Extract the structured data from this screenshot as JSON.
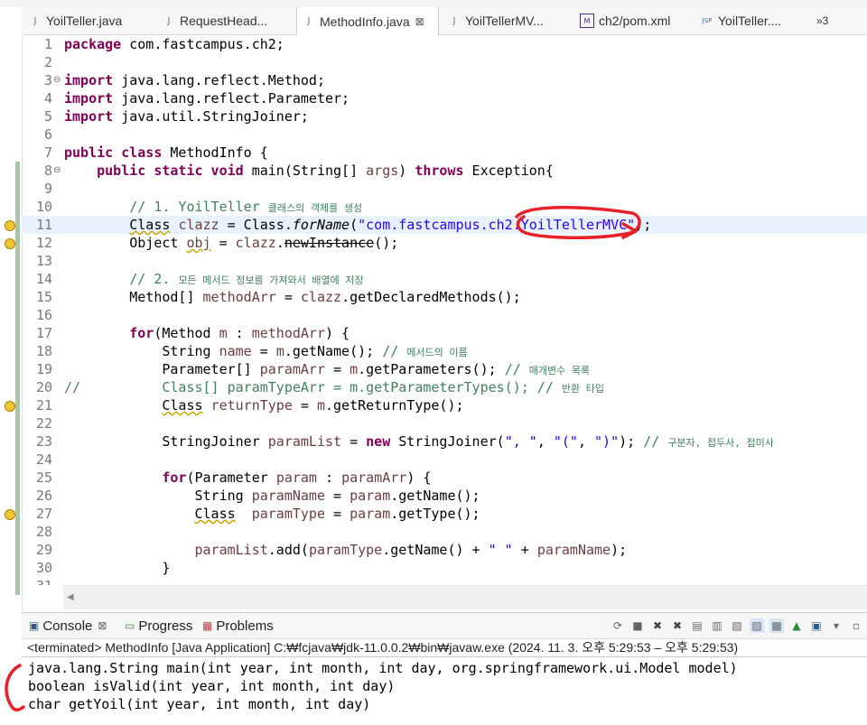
{
  "tabs": [
    {
      "label": "YoilTeller.java",
      "icon": "java-file-icon"
    },
    {
      "label": "RequestHead...",
      "icon": "java-file-icon"
    },
    {
      "label": "MethodInfo.java",
      "icon": "java-file-icon",
      "active": true,
      "close": "⊠"
    },
    {
      "label": "YoilTellerMV...",
      "icon": "java-file-icon"
    },
    {
      "label": "ch2/pom.xml",
      "icon": "maven-file-icon"
    },
    {
      "label": "YoilTeller....",
      "icon": "jsp-file-icon"
    }
  ],
  "overflow_label": "»3",
  "editor": {
    "lines": [
      {
        "n": "1",
        "h": "<span class='kw'>package</span> com.fastcampus.ch2;"
      },
      {
        "n": "2",
        "h": ""
      },
      {
        "n": "3",
        "h": "<span class='kw'>import</span> java.lang.reflect.Method;",
        "fold": true
      },
      {
        "n": "4",
        "h": "<span class='kw'>import</span> java.lang.reflect.Parameter;"
      },
      {
        "n": "5",
        "h": "<span class='kw'>import</span> java.util.StringJoiner;"
      },
      {
        "n": "6",
        "h": ""
      },
      {
        "n": "7",
        "h": "<span class='kw'>public class</span> MethodInfo {"
      },
      {
        "n": "8",
        "h": "    <span class='kw'>public static void</span> main(String[] <span class='var'>args</span>) <span class='kw'>throws</span> Exception{",
        "fold": true
      },
      {
        "n": "9",
        "h": ""
      },
      {
        "n": "10",
        "h": "        <span class='cm'>// 1. YoilTeller <span class='ko'>클래스의 객체를 생성</span></span>"
      },
      {
        "n": "11",
        "h": "        <span class='warn'>Class</span> <span class='var'>clazz</span> = Class.<span class='it'>forName</span>(<span class='str'>\"com.fastcampus.ch2.YoilTellerMVC\"</span>);",
        "cur": true,
        "warn": true
      },
      {
        "n": "12",
        "h": "        Object <span class='var warn'>obj</span> = <span class='var'>clazz</span>.<span class='strike'>newInstance</span>();",
        "warn": true
      },
      {
        "n": "13",
        "h": ""
      },
      {
        "n": "14",
        "h": "        <span class='cm'>// 2. <span class='ko'>모든 메서드 정보를 가져와서 배열에 저장</span></span>"
      },
      {
        "n": "15",
        "h": "        Method[] <span class='var'>methodArr</span> = <span class='var'>clazz</span>.getDeclaredMethods();"
      },
      {
        "n": "16",
        "h": ""
      },
      {
        "n": "17",
        "h": "        <span class='kw'>for</span>(Method <span class='var'>m</span> : <span class='var'>methodArr</span>) {"
      },
      {
        "n": "18",
        "h": "            String <span class='var'>name</span> = <span class='var'>m</span>.getName(); <span class='cm'>// <span class='ko'>메서드의 이름</span></span>"
      },
      {
        "n": "19",
        "h": "            Parameter[] <span class='var'>paramArr</span> = <span class='var'>m</span>.getParameters(); <span class='cm'>// <span class='ko'>매개변수 목록</span></span>"
      },
      {
        "n": "20",
        "h": "<span class='cm'>//          Class[] paramTypeArr = m.getParameterTypes(); // <span class='ko'>반환 타입</span></span>"
      },
      {
        "n": "21",
        "h": "            <span class='warn'>Class</span> <span class='var'>returnType</span> = <span class='var'>m</span>.getReturnType();",
        "warn": true
      },
      {
        "n": "22",
        "h": ""
      },
      {
        "n": "23",
        "h": "            StringJoiner <span class='var'>paramList</span> = <span class='kw'>new</span> StringJoiner(<span class='str'>\", \"</span>, <span class='str'>\"(\"</span>, <span class='str'>\")\"</span>); <span class='cm'>// <span class='ko'>구분자, 접두사, 접미사</span></span>"
      },
      {
        "n": "24",
        "h": ""
      },
      {
        "n": "25",
        "h": "            <span class='kw'>for</span>(Parameter <span class='var'>param</span> : <span class='var'>paramArr</span>) {"
      },
      {
        "n": "26",
        "h": "                String <span class='var'>paramName</span> = <span class='var'>param</span>.getName();"
      },
      {
        "n": "27",
        "h": "                <span class='warn'>Class</span>  <span class='var'>paramType</span> = <span class='var'>param</span>.getType();",
        "warn": true
      },
      {
        "n": "28",
        "h": ""
      },
      {
        "n": "29",
        "h": "                <span class='var'>paramList</span>.add(<span class='var'>paramType</span>.getName() + <span class='str'>\" \"</span> + <span class='var'>paramName</span>);"
      },
      {
        "n": "30",
        "h": "            }"
      },
      {
        "n": "31",
        "h": ""
      }
    ]
  },
  "bottom_panel": {
    "tabs": [
      {
        "label": "Console",
        "icon": "console-icon",
        "close": "⊠"
      },
      {
        "label": "Progress",
        "icon": "progress-icon"
      },
      {
        "label": "Problems",
        "icon": "problems-icon"
      }
    ],
    "status": "<terminated> MethodInfo [Java Application] C:₩fcjava₩jdk-11.0.0.2₩bin₩javaw.exe  (2024. 11. 3. 오후 5:29:53 – 오후 5:29:53)",
    "output": [
      "java.lang.String main(int year, int month, int day, org.springframework.ui.Model model)",
      "boolean isValid(int year, int month, int day)",
      "char getYoil(int year, int month, int day)"
    ]
  },
  "colors": {
    "keyword": "#7f0055",
    "string": "#2a00ff",
    "comment": "#3f7f5f",
    "annotation": "#e8202a"
  }
}
